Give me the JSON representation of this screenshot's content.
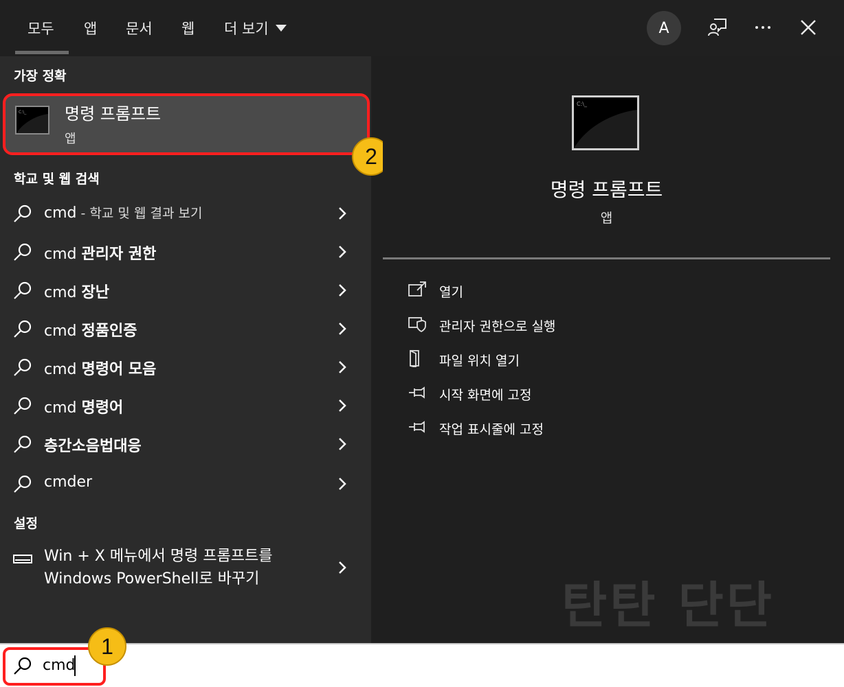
{
  "tabs": [
    {
      "label": "모두"
    },
    {
      "label": "앱"
    },
    {
      "label": "문서"
    },
    {
      "label": "웹"
    },
    {
      "label": "더 보기"
    }
  ],
  "avatar_letter": "A",
  "sections": {
    "best_match": "가장 정확",
    "school_web": "학교 및 웹 검색",
    "settings": "설정"
  },
  "best_match": {
    "title": "명령 프롬프트",
    "subtitle": "앱"
  },
  "badges": {
    "one": "1",
    "two": "2"
  },
  "suggestions": [
    {
      "prefix": "cmd",
      "bold": "",
      "dim": " - 학교 및 웹 결과 보기"
    },
    {
      "prefix": "cmd ",
      "bold": "관리자 권한",
      "dim": ""
    },
    {
      "prefix": "cmd ",
      "bold": "장난",
      "dim": ""
    },
    {
      "prefix": "cmd ",
      "bold": "정품인증",
      "dim": ""
    },
    {
      "prefix": "cmd ",
      "bold": "명령어 모음",
      "dim": ""
    },
    {
      "prefix": "cmd ",
      "bold": "명령어",
      "dim": ""
    },
    {
      "prefix": "",
      "bold": "층간소음법대응",
      "dim": ""
    },
    {
      "prefix": "cmder",
      "bold": "",
      "dim": ""
    }
  ],
  "setting_item": {
    "line1": "Win + X 메뉴에서 명령 프롬프트를",
    "line2": "Windows PowerShell로 바꾸기"
  },
  "preview": {
    "title": "명령 프롬프트",
    "subtitle": "앱"
  },
  "actions": [
    {
      "label": "열기",
      "icon": "open-icon"
    },
    {
      "label": "관리자 권한으로 실행",
      "icon": "admin-shield-icon"
    },
    {
      "label": "파일 위치 열기",
      "icon": "file-location-icon"
    },
    {
      "label": "시작 화면에 고정",
      "icon": "pin-icon"
    },
    {
      "label": "작업 표시줄에 고정",
      "icon": "pin-icon"
    }
  ],
  "watermark": "탄탄 단단",
  "search": {
    "value": "cmd"
  }
}
